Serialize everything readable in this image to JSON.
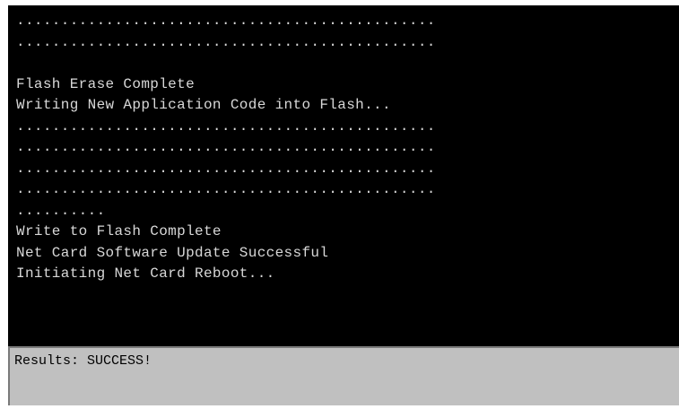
{
  "terminal": {
    "lines": [
      "...............................................",
      "...............................................",
      "",
      "Flash Erase Complete",
      "Writing New Application Code into Flash...",
      "...............................................",
      "...............................................",
      "...............................................",
      "...............................................",
      "..........",
      "Write to Flash Complete",
      "Net Card Software Update Successful",
      "Initiating Net Card Reboot..."
    ]
  },
  "results": {
    "text": "Results: SUCCESS!"
  }
}
